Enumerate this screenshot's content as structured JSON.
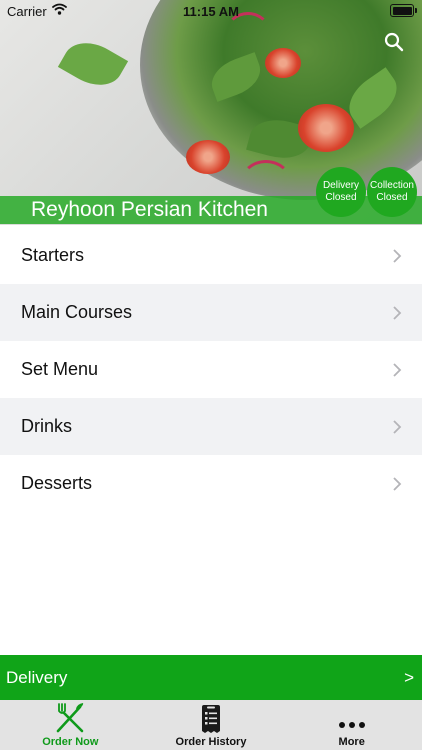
{
  "status_bar": {
    "carrier": "Carrier",
    "time": "11:15 AM"
  },
  "header": {
    "restaurant_name": "Reyhoon Persian Kitchen",
    "delivery_status": {
      "line1": "Delivery",
      "line2": "Closed"
    },
    "collection_status": {
      "line1": "Collection",
      "line2": "Closed"
    }
  },
  "menu": {
    "items": [
      {
        "label": "Starters"
      },
      {
        "label": "Main Courses"
      },
      {
        "label": "Set Menu"
      },
      {
        "label": "Drinks"
      },
      {
        "label": "Desserts"
      }
    ]
  },
  "order_mode": {
    "label": "Delivery",
    "arrow": ">"
  },
  "tabs": [
    {
      "label": "Order Now",
      "icon": "fork-knife-icon",
      "active": true
    },
    {
      "label": "Order History",
      "icon": "receipt-icon",
      "active": false
    },
    {
      "label": "More",
      "icon": "more-dots-icon",
      "active": false
    }
  ],
  "colors": {
    "brand_green": "#10a418",
    "active_tab": "#0f9a1a",
    "row_alt": "#f1f2f4"
  }
}
